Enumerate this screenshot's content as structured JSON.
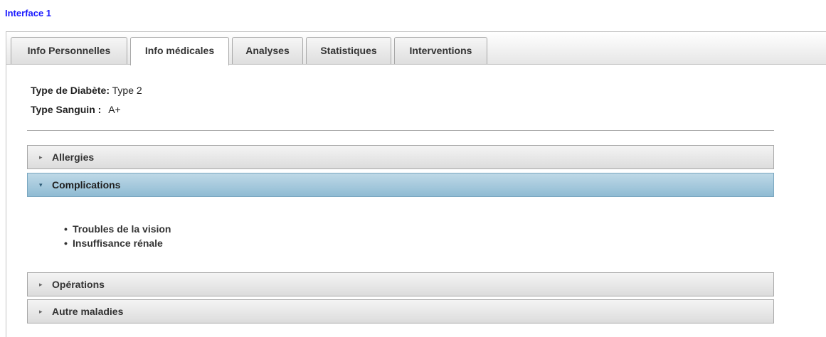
{
  "page": {
    "title": "Interface 1"
  },
  "tabs": [
    {
      "label": "Info Personnelles",
      "active": false
    },
    {
      "label": "Info médicales",
      "active": true
    },
    {
      "label": "Analyses",
      "active": false
    },
    {
      "label": "Statistiques",
      "active": false
    },
    {
      "label": "Interventions",
      "active": false
    }
  ],
  "medical_info": {
    "diabetes_type_label": "Type de Diabète:",
    "diabetes_type_value": "Type 2",
    "blood_type_label": "Type Sanguin :",
    "blood_type_value": "A+"
  },
  "accordion": {
    "panels": [
      {
        "label": "Allergies",
        "expanded": false
      },
      {
        "label": "Complications",
        "expanded": true,
        "items": [
          "Troubles de la vision",
          "Insuffisance rénale"
        ]
      },
      {
        "label": "Opérations",
        "expanded": false
      },
      {
        "label": "Autre maladies",
        "expanded": false
      }
    ],
    "bullet": "•",
    "caret_collapsed": "▸",
    "caret_expanded": "▾"
  },
  "colors": {
    "title": "#1a1aff",
    "active_panel": "#8fbbd3"
  }
}
